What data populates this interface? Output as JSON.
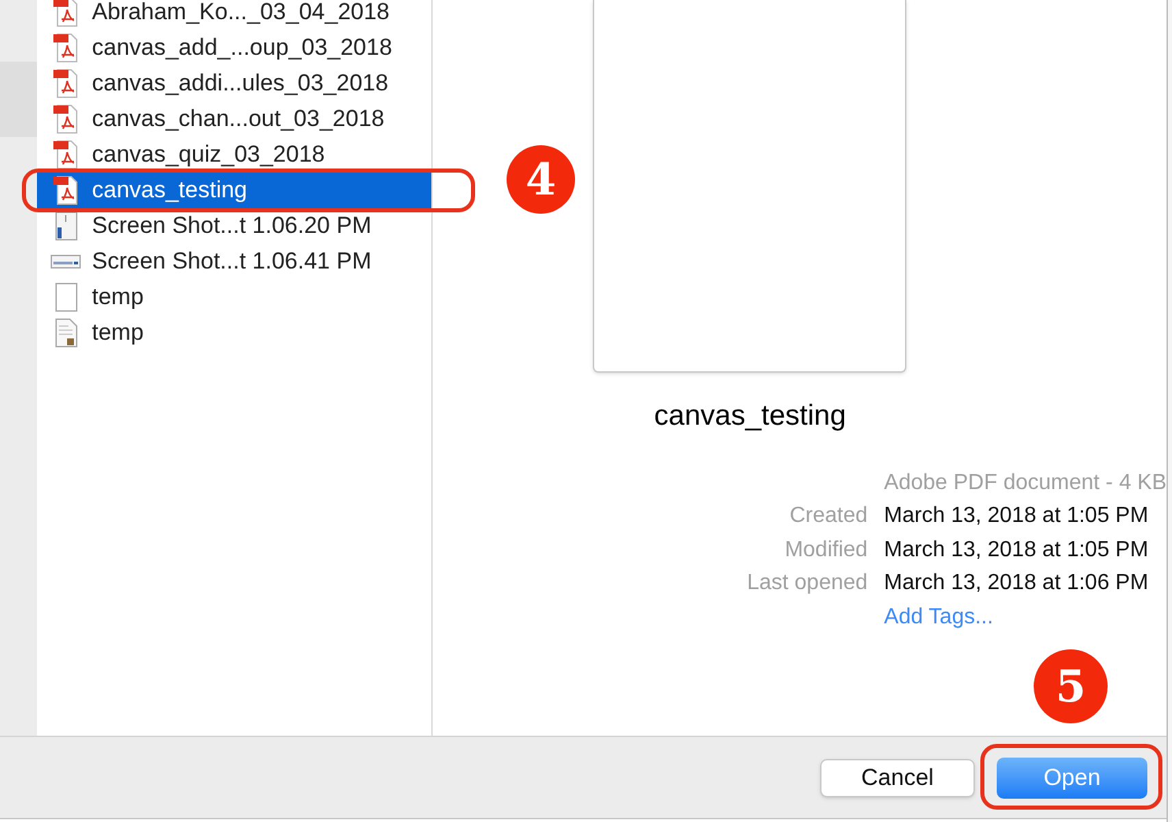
{
  "files": [
    {
      "name": "Abraham_Ko..._03_04_2018",
      "kind": "pdf",
      "selected": false
    },
    {
      "name": "canvas_add_...oup_03_2018",
      "kind": "pdf",
      "selected": false
    },
    {
      "name": "canvas_addi...ules_03_2018",
      "kind": "pdf",
      "selected": false
    },
    {
      "name": "canvas_chan...out_03_2018",
      "kind": "pdf",
      "selected": false
    },
    {
      "name": "canvas_quiz_03_2018",
      "kind": "pdf",
      "selected": false
    },
    {
      "name": "canvas_testing",
      "kind": "pdf",
      "selected": true
    },
    {
      "name": "Screen Shot...t 1.06.20 PM",
      "kind": "image",
      "selected": false
    },
    {
      "name": "Screen Shot...t 1.06.41 PM",
      "kind": "image-wide",
      "selected": false
    },
    {
      "name": "temp",
      "kind": "blank",
      "selected": false
    },
    {
      "name": "temp",
      "kind": "document",
      "selected": false
    }
  ],
  "preview": {
    "title": "canvas_testing",
    "type": "Adobe PDF document - 4 KB",
    "details": [
      {
        "label": "Created",
        "value": "March 13, 2018 at 1:05 PM"
      },
      {
        "label": "Modified",
        "value": "March 13, 2018 at 1:05 PM"
      },
      {
        "label": "Last opened",
        "value": "March 13, 2018 at 1:06 PM"
      }
    ],
    "add_tags": "Add Tags..."
  },
  "buttons": [
    {
      "label": "Cancel",
      "kind": "secondary"
    },
    {
      "label": "Open",
      "kind": "primary"
    }
  ],
  "annotations": [
    {
      "label": "4"
    },
    {
      "label": "5"
    }
  ]
}
